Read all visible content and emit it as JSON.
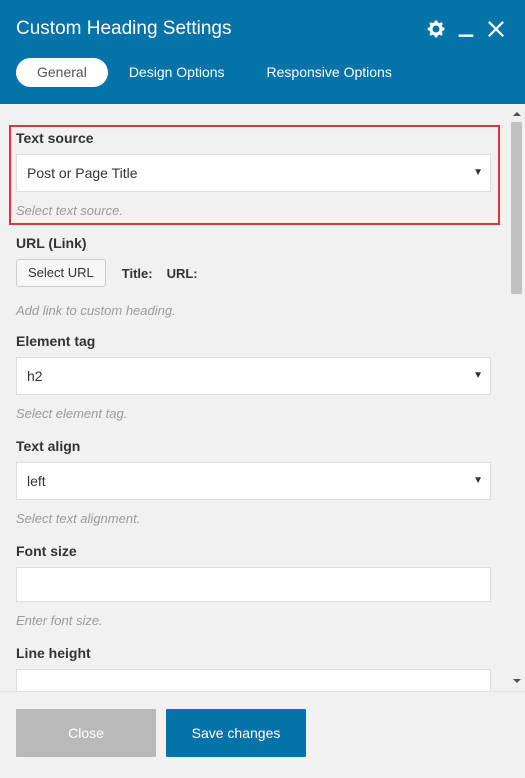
{
  "header": {
    "title": "Custom Heading Settings",
    "icons": [
      "gear-icon",
      "minimize-icon",
      "close-icon"
    ],
    "tabs": [
      {
        "label": "General",
        "active": true
      },
      {
        "label": "Design Options",
        "active": false
      },
      {
        "label": "Responsive Options",
        "active": false
      }
    ]
  },
  "fields": {
    "text_source": {
      "label": "Text source",
      "value": "Post or Page Title",
      "description": "Select text source."
    },
    "url": {
      "label": "URL (Link)",
      "button": "Select URL",
      "title_label": "Title:",
      "url_label": "URL:",
      "description": "Add link to custom heading."
    },
    "element_tag": {
      "label": "Element tag",
      "value": "h2",
      "description": "Select element tag."
    },
    "text_align": {
      "label": "Text align",
      "value": "left",
      "description": "Select text alignment."
    },
    "font_size": {
      "label": "Font size",
      "value": "",
      "description": "Enter font size."
    },
    "line_height": {
      "label": "Line height",
      "value": ""
    }
  },
  "footer": {
    "close_label": "Close",
    "save_label": "Save changes"
  },
  "colors": {
    "header_bg": "#0473aa",
    "save_bg": "#0473aa",
    "close_bg": "#b9b9b9",
    "highlight_border": "#d9363e"
  }
}
